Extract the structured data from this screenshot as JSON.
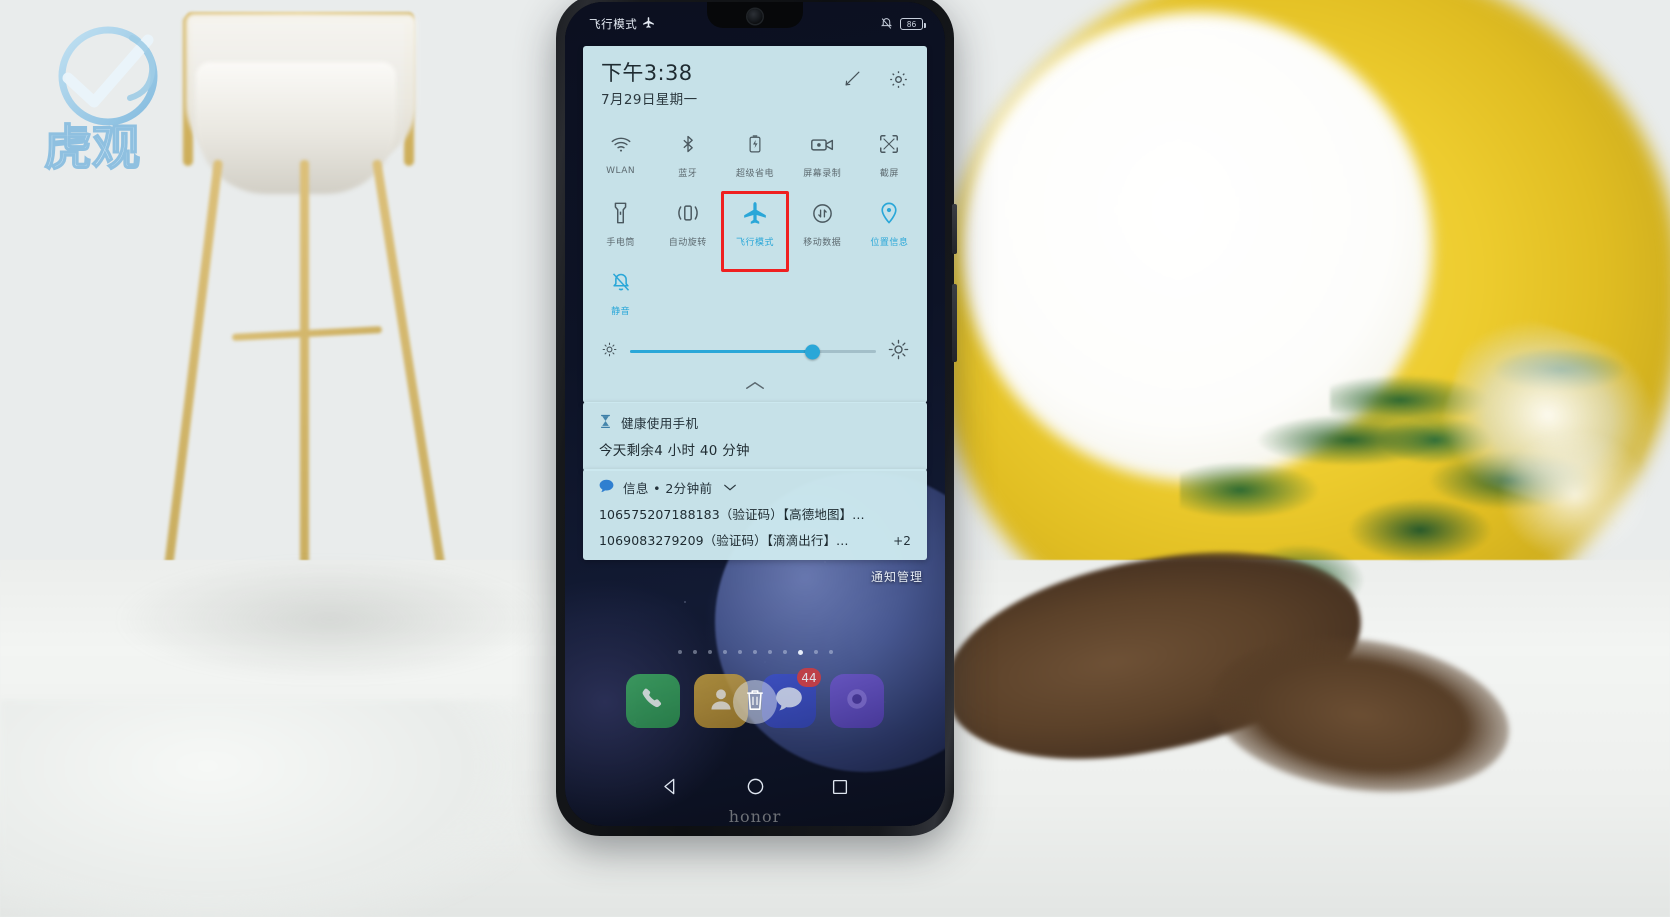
{
  "watermark": {
    "text_top": "虎观",
    "alt": "huguan-logo"
  },
  "phone": {
    "brand": "honor",
    "status_bar": {
      "airplane_label": "飞行模式",
      "airplane_icon": "airplane-icon",
      "mute_icon": "bell-off-icon",
      "battery_level": "86"
    },
    "quick_settings": {
      "time": "下午3:38",
      "date": "7月29日星期一",
      "edit_icon": "edit-pencil-icon",
      "settings_icon": "gear-icon",
      "tiles": [
        {
          "label": "WLAN",
          "icon": "wifi-icon",
          "active": false
        },
        {
          "label": "蓝牙",
          "icon": "bluetooth-icon",
          "active": false
        },
        {
          "label": "超级省电",
          "icon": "battery-saver-icon",
          "active": false
        },
        {
          "label": "屏幕录制",
          "icon": "screen-record-icon",
          "active": false
        },
        {
          "label": "截屏",
          "icon": "screenshot-icon",
          "active": false
        },
        {
          "label": "手电筒",
          "icon": "flashlight-icon",
          "active": false
        },
        {
          "label": "自动旋转",
          "icon": "auto-rotate-icon",
          "active": false
        },
        {
          "label": "飞行模式",
          "icon": "airplane-icon",
          "active": true
        },
        {
          "label": "移动数据",
          "icon": "mobile-data-icon",
          "active": false
        },
        {
          "label": "位置信息",
          "icon": "location-pin-icon",
          "active": true
        },
        {
          "label": "静音",
          "icon": "bell-off-icon",
          "active": true
        }
      ],
      "highlighted_tile": "飞行模式",
      "highlight_color": "#ef2020",
      "accent_color": "#2aa7d8",
      "panel_color": "#cce8ee",
      "brightness": {
        "low_icon": "brightness-low-icon",
        "high_icon": "brightness-high-icon",
        "value_percent": 74
      },
      "collapse_icon": "chevron-up-icon"
    },
    "notifications": [
      {
        "app_icon": "hourglass-icon",
        "title": "健康使用手机",
        "body": "今天剩余4 小时 40 分钟"
      },
      {
        "app_icon": "message-bubble-icon",
        "title": "信息 • 2分钟前",
        "expand_icon": "chevron-down-icon",
        "lines": [
          "106575207188183（验证码）【高德地图】…",
          "1069083279209（验证码）【滴滴出行】…"
        ],
        "more_count": "+2"
      }
    ],
    "notification_manage_label": "通知管理",
    "home": {
      "page_dots": 11,
      "active_dot_index": 8,
      "dock_apps": [
        {
          "name": "phone-app",
          "icon": "phone-handset-icon"
        },
        {
          "name": "contacts-app",
          "icon": "person-icon"
        },
        {
          "name": "messages-app",
          "icon": "chat-bubble-icon",
          "badge": "44"
        },
        {
          "name": "gallery-app",
          "icon": "gallery-icon"
        }
      ],
      "drag_target": {
        "name": "remove-app",
        "icon": "trash-icon"
      }
    },
    "navigation": [
      {
        "name": "back-button",
        "icon": "triangle-back-icon"
      },
      {
        "name": "home-button",
        "icon": "circle-home-icon"
      },
      {
        "name": "recents-button",
        "icon": "square-recents-icon"
      }
    ]
  }
}
